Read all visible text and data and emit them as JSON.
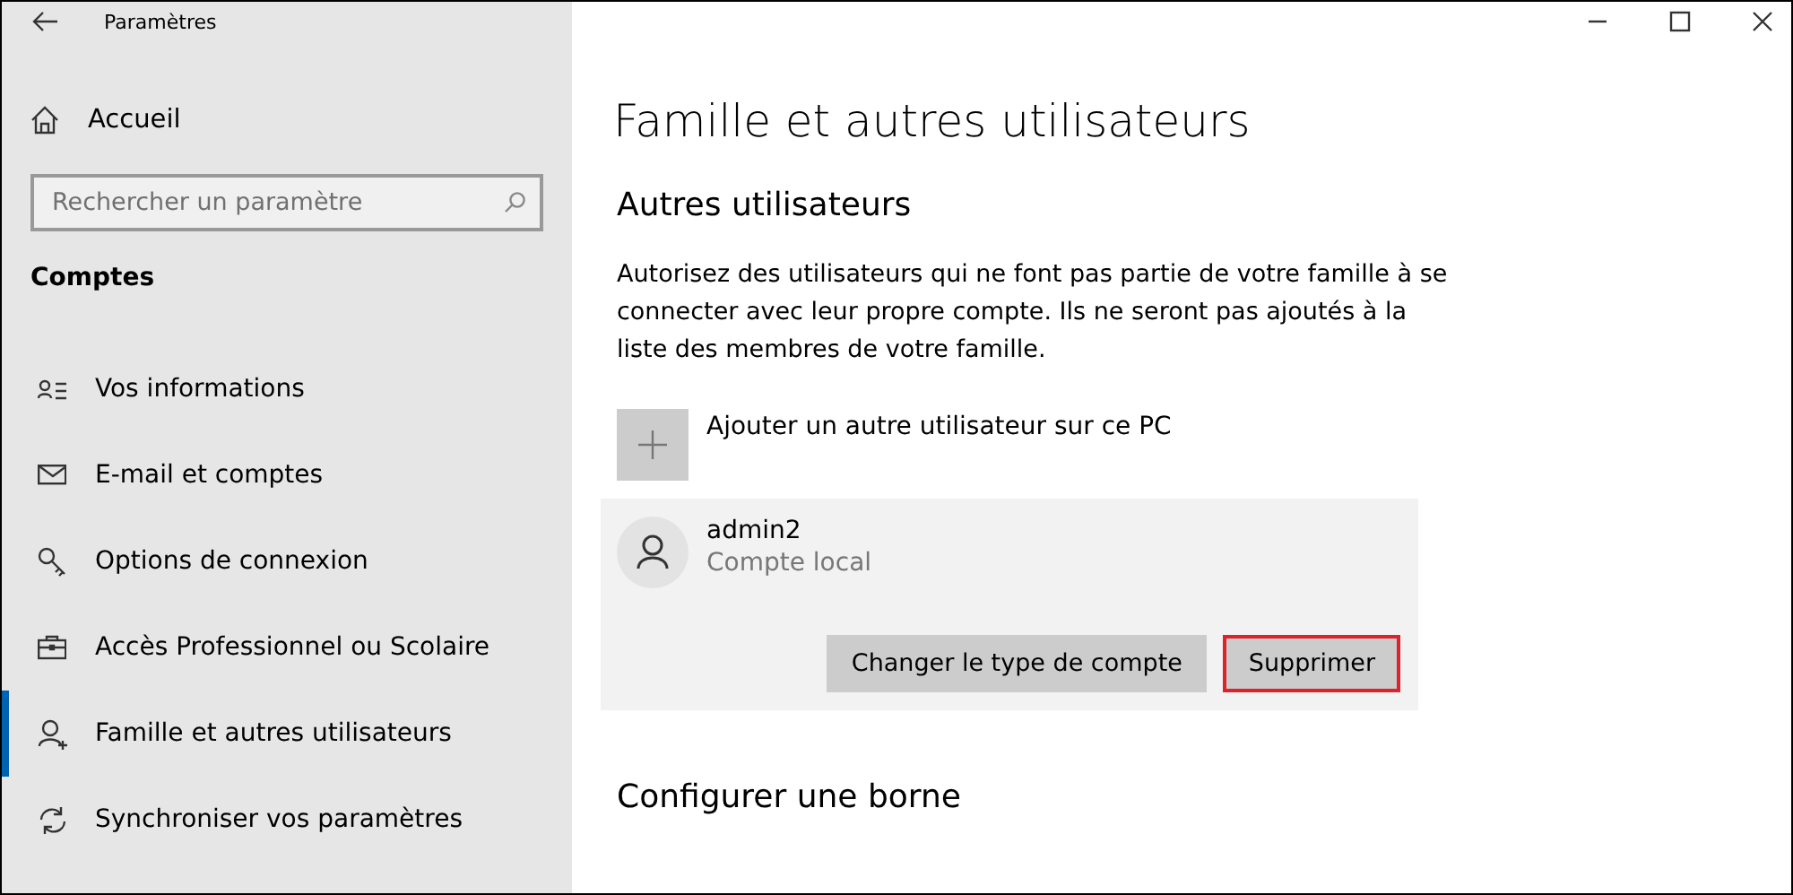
{
  "window": {
    "title": "Paramètres"
  },
  "sidebar": {
    "home": "Accueil",
    "search": {
      "placeholder": "Rechercher un paramètre"
    },
    "section": "Comptes",
    "items": [
      {
        "label": "Vos informations",
        "kind": "info",
        "selected": false
      },
      {
        "label": "E-mail et comptes",
        "kind": "mail",
        "selected": false
      },
      {
        "label": "Options de connexion",
        "kind": "key",
        "selected": false
      },
      {
        "label": "Accès Professionnel ou Scolaire",
        "kind": "briefcase",
        "selected": false
      },
      {
        "label": "Famille et autres utilisateurs",
        "kind": "family",
        "selected": true
      },
      {
        "label": "Synchroniser vos paramètres",
        "kind": "sync",
        "selected": false
      }
    ]
  },
  "main": {
    "title": "Famille et autres utilisateurs",
    "section": "Autres utilisateurs",
    "description": "Autorisez des utilisateurs qui ne font pas partie de votre famille à se connecter avec leur propre compte. Ils ne seront pas ajoutés à la liste des membres de votre famille.",
    "add_user": "Ajouter un autre utilisateur sur ce PC",
    "user": {
      "name": "admin2",
      "type": "Compte local",
      "buttons": [
        {
          "label": "Changer le type de compte",
          "highlighted": false
        },
        {
          "label": "Supprimer",
          "highlighted": true
        }
      ]
    },
    "next_section": "Configurer une borne"
  }
}
